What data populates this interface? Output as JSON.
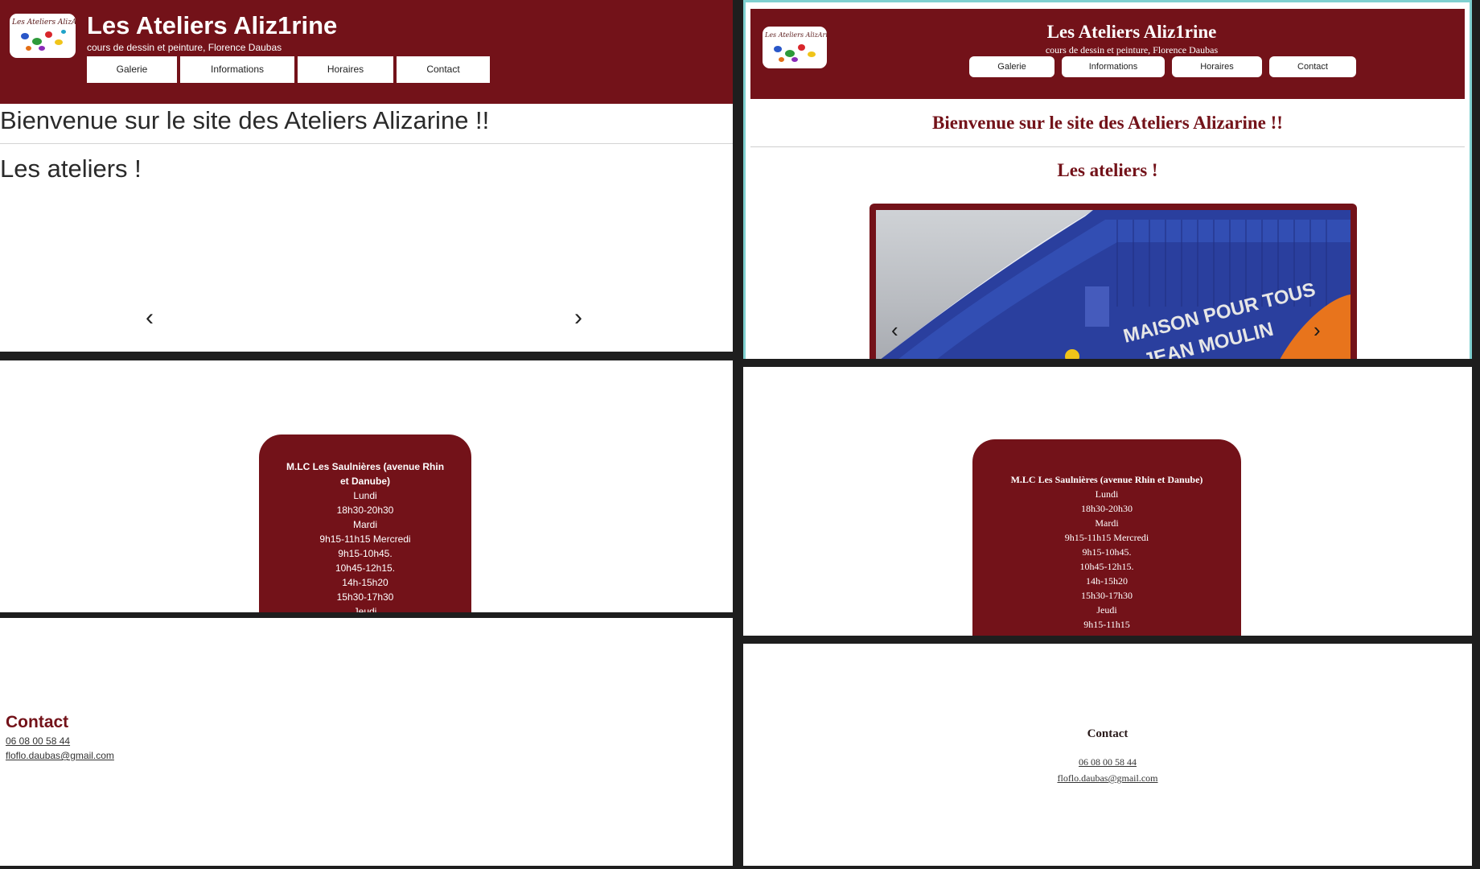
{
  "site": {
    "title": "Les Ateliers Aliz1rine",
    "subtitle": "cours de dessin et peinture, Florence Daubas",
    "logo_text": "Les Ateliers AlizArine"
  },
  "nav": {
    "items": [
      "Galerie",
      "Informations",
      "Horaires",
      "Contact"
    ]
  },
  "main": {
    "welcome": "Bienvenue sur le site des Ateliers Alizarine !!",
    "ateliers_heading": "Les ateliers !",
    "prev_arrow": "‹",
    "next_arrow": "›"
  },
  "carousel": {
    "image_text_line1": "MAISON POUR TOUS",
    "image_text_line2": "JEAN MOULIN"
  },
  "schedule": {
    "location": "M.LC Les Saulnières (avenue Rhin et Danube)",
    "lines": [
      "Lundi",
      "18h30-20h30",
      "Mardi",
      "9h15-11h15 Mercredi",
      "9h15-10h45.",
      "10h45-12h15.",
      "14h-15h20",
      "15h30-17h30",
      "Jeudi",
      "9h15-11h15"
    ]
  },
  "contact": {
    "title": "Contact",
    "phone": "06 08 00 58 44",
    "email": "floflo.daubas@gmail.com"
  },
  "colors": {
    "brand": "#731219",
    "accent_border": "#7fd0d0"
  }
}
